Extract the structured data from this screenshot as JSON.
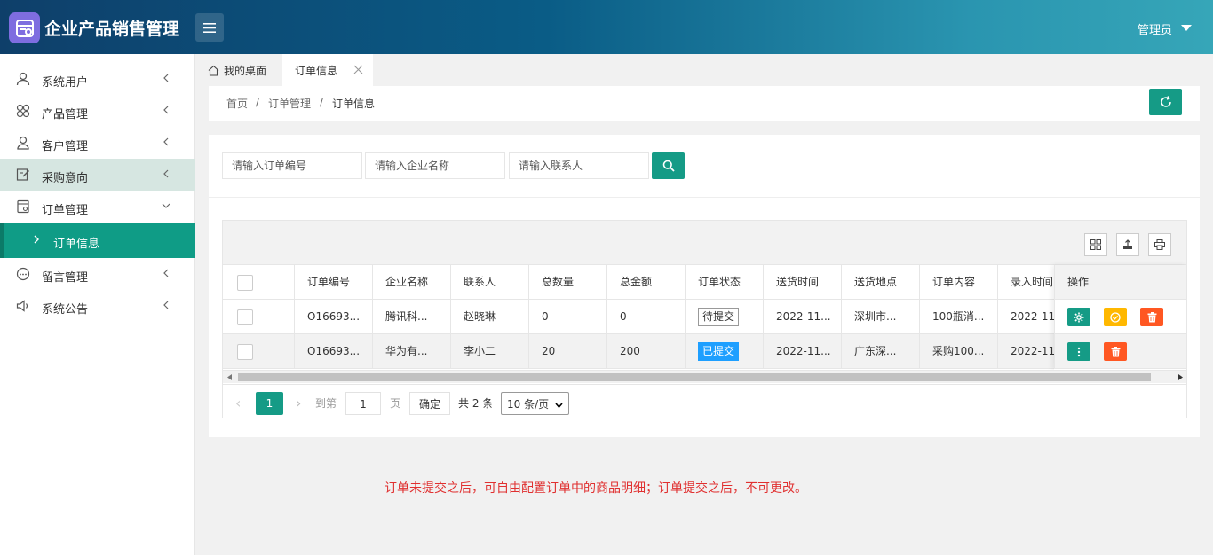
{
  "app": {
    "title": "企业产品销售管理",
    "user": "管理员"
  },
  "sidebar": {
    "items": [
      {
        "label": "系统用户",
        "icon": "user-icon"
      },
      {
        "label": "产品管理",
        "icon": "grid-icon"
      },
      {
        "label": "客户管理",
        "icon": "person-icon"
      },
      {
        "label": "采购意向",
        "icon": "edit-icon"
      },
      {
        "label": "订单管理",
        "icon": "order-icon"
      },
      {
        "label": "订单信息",
        "icon": "chevron-right-icon"
      },
      {
        "label": "留言管理",
        "icon": "chat-icon"
      },
      {
        "label": "系统公告",
        "icon": "speaker-icon"
      }
    ]
  },
  "tabs": {
    "home": "我的桌面",
    "orders": "订单信息"
  },
  "breadcrumb": {
    "home": "首页",
    "sep": "/",
    "section": "订单管理",
    "page": "订单信息"
  },
  "search": {
    "order_no_placeholder": "请输入订单编号",
    "company_placeholder": "请输入企业名称",
    "contact_placeholder": "请输入联系人"
  },
  "table": {
    "columns": [
      "订单编号",
      "企业名称",
      "联系人",
      "总数量",
      "总金额",
      "订单状态",
      "送货时间",
      "送货地点",
      "订单内容",
      "录入时间",
      "操作"
    ],
    "rows": [
      {
        "order_no": "O16693...",
        "company": "腾讯科...",
        "contact": "赵晓琳",
        "qty": "0",
        "amount": "0",
        "status": "待提交",
        "delivery_time": "2022-11...",
        "address": "深圳市...",
        "content": "100瓶消...",
        "created": "2022-11..."
      },
      {
        "order_no": "O16693...",
        "company": "华为有...",
        "contact": "李小二",
        "qty": "20",
        "amount": "200",
        "status": "已提交",
        "delivery_time": "2022-11...",
        "address": "广东深...",
        "content": "采购100...",
        "created": "2022-11..."
      }
    ]
  },
  "pager": {
    "prev": "‹",
    "current": "1",
    "next": "›",
    "goto": "到第",
    "page_value": "1",
    "page_unit": "页",
    "confirm": "确定",
    "total": "共 2 条",
    "page_size": "10 条/页"
  },
  "note": "订单未提交之后，可自由配置订单中的商品明细；订单提交之后，不可更改。",
  "colors": {
    "accent": "#159b86",
    "pending_border": "#999999",
    "submitted": "#1e9fff",
    "warn": "#ffb800",
    "danger": "#ff5722"
  }
}
